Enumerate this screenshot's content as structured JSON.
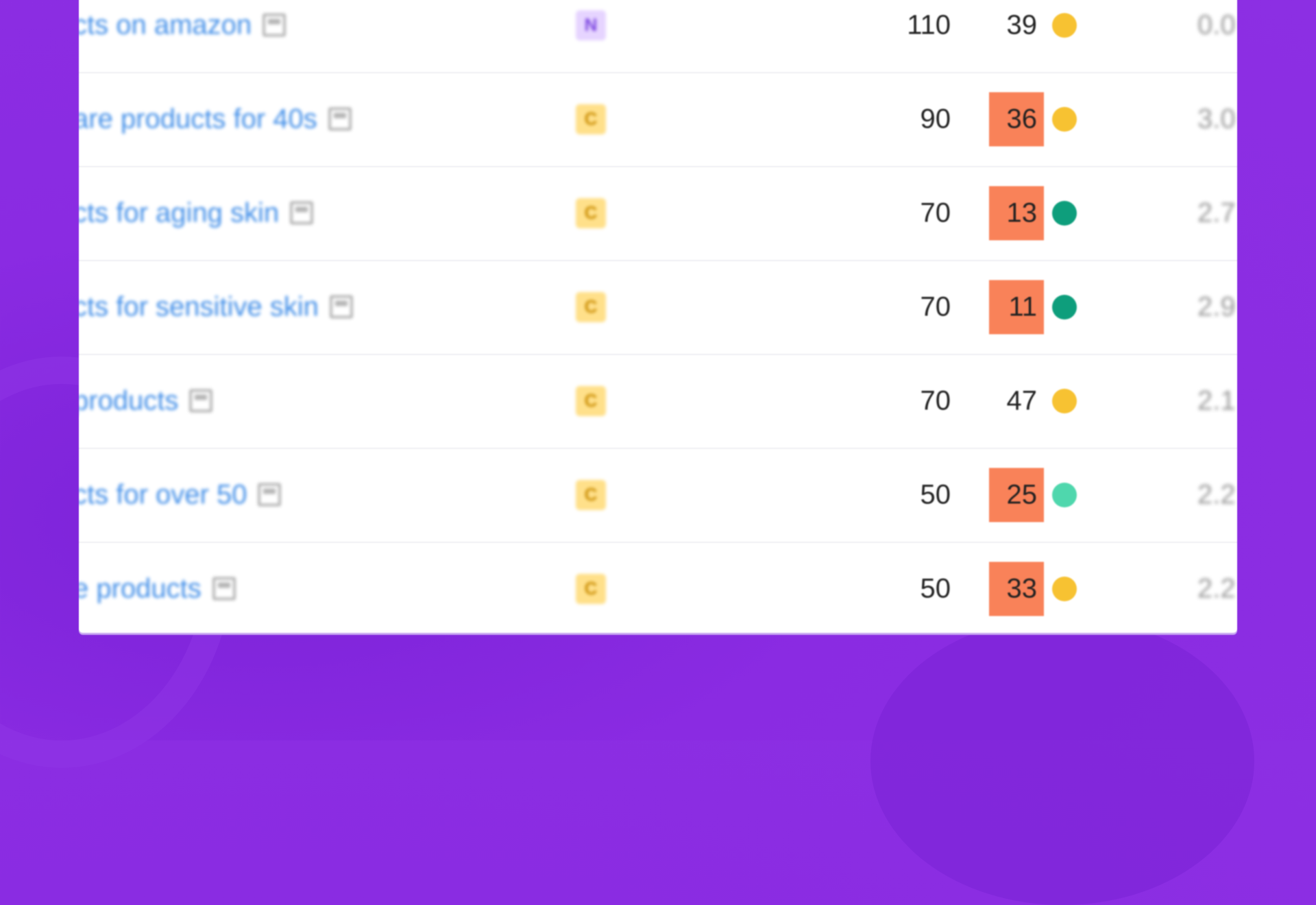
{
  "colors": {
    "background": "#8a2be2",
    "keyword_link": "#3f8de8",
    "kd_highlight": "#f98259",
    "dot_yellow": "#f7c232",
    "dot_dark_green": "#0e9e7c",
    "dot_light_green": "#4fd7ad",
    "intent_N_bg": "#e6d4ff",
    "intent_C_bg": "#ffe08a"
  },
  "rows": [
    {
      "keyword": "cts on amazon",
      "intent": "N",
      "volume": "110",
      "kd": "39",
      "kd_highlight": false,
      "dot": "yellow",
      "cpc": "0.0"
    },
    {
      "keyword": "are products for 40s",
      "intent": "C",
      "volume": "90",
      "kd": "36",
      "kd_highlight": true,
      "dot": "yellow",
      "cpc": "3.0"
    },
    {
      "keyword": "cts for aging skin",
      "intent": "C",
      "volume": "70",
      "kd": "13",
      "kd_highlight": true,
      "dot": "dark_green",
      "cpc": "2.7"
    },
    {
      "keyword": "cts for sensitive skin",
      "intent": "C",
      "volume": "70",
      "kd": "11",
      "kd_highlight": true,
      "dot": "dark_green",
      "cpc": "2.9"
    },
    {
      "keyword": "products",
      "intent": "C",
      "volume": "70",
      "kd": "47",
      "kd_highlight": false,
      "dot": "yellow",
      "cpc": "2.1"
    },
    {
      "keyword": "cts for over 50",
      "intent": "C",
      "volume": "50",
      "kd": "25",
      "kd_highlight": true,
      "dot": "light_green",
      "cpc": "2.2"
    },
    {
      "keyword": "e products",
      "intent": "C",
      "volume": "50",
      "kd": "33",
      "kd_highlight": true,
      "dot": "yellow",
      "cpc": "2.2"
    }
  ]
}
